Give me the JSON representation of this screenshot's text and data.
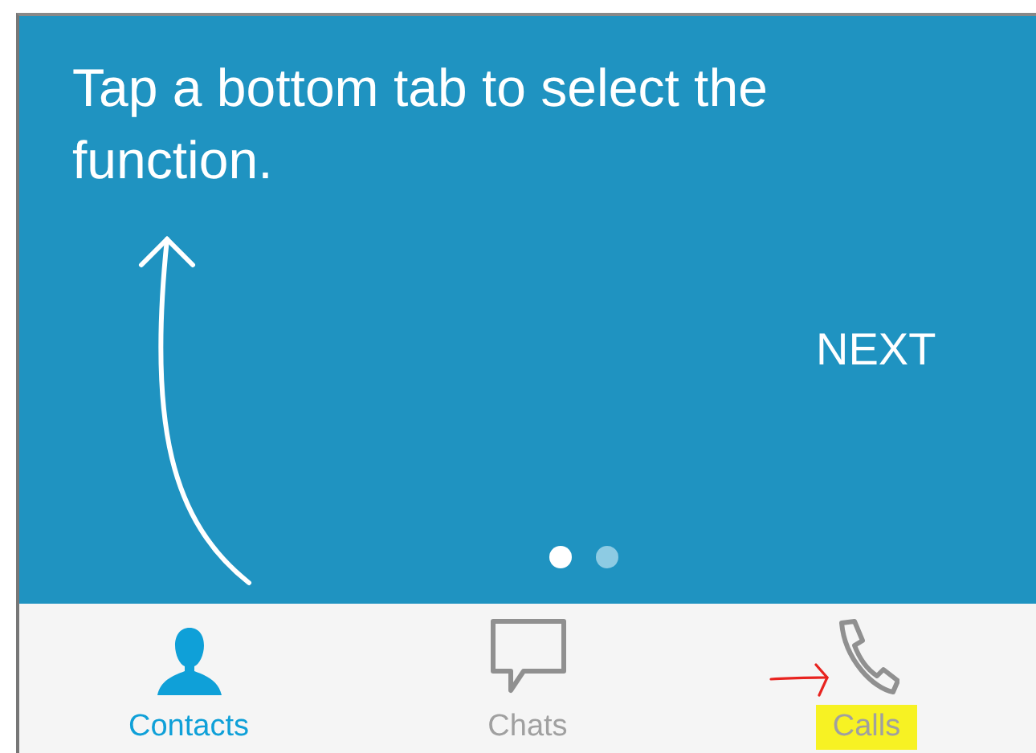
{
  "tutorial": {
    "message": "Tap a bottom tab to select the function.",
    "next_button": "NEXT",
    "pages": [
      {
        "selected": true
      },
      {
        "selected": false
      }
    ]
  },
  "tabs": [
    {
      "label": "Contacts",
      "kind": "contacts",
      "selected": true,
      "highlighted": false
    },
    {
      "label": "Chats",
      "kind": "chats",
      "selected": false,
      "highlighted": false
    },
    {
      "label": "Calls",
      "kind": "calls",
      "selected": false,
      "highlighted": true
    }
  ]
}
